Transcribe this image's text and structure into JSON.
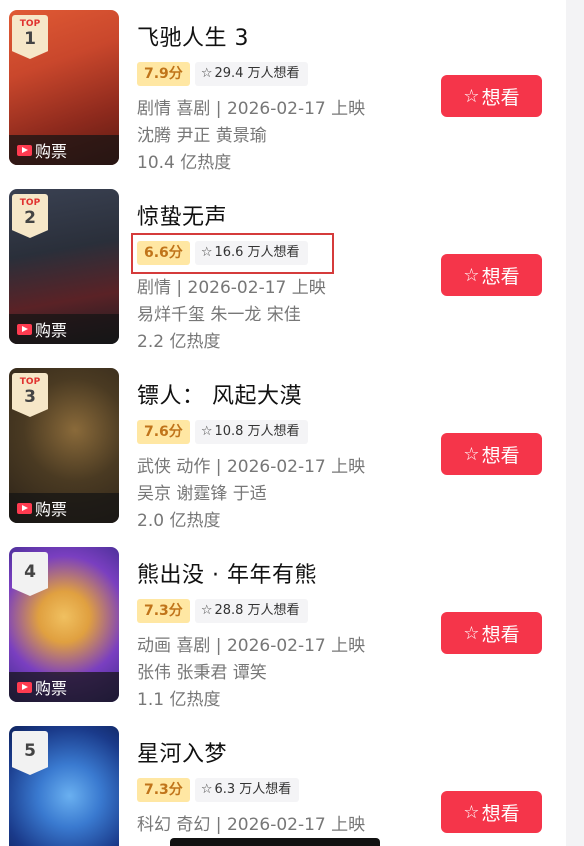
{
  "buy_label": "购票",
  "want_label": "想看",
  "top_label": "TOP",
  "movies": [
    {
      "rank": "1",
      "top": true,
      "title": "飞驰人生 3",
      "score": "7.9分",
      "wish": "29.4 万人想看",
      "genre_line": "剧情 喜剧 | 2026-02-17 上映",
      "cast": "沈腾 尹正 黄景瑜",
      "heat": "10.4 亿热度",
      "poster_colors": [
        "#c9472c",
        "#8e2a1d",
        "#e59a50"
      ]
    },
    {
      "rank": "2",
      "top": true,
      "title": "惊蛰无声",
      "score": "6.6分",
      "wish": "16.6 万人想看",
      "genre_line": "剧情 | 2026-02-17 上映",
      "cast": "易烊千玺 朱一龙 宋佳",
      "heat": "2.2 亿热度",
      "poster_colors": [
        "#2a2f3a",
        "#5a2226",
        "#1a1c22"
      ]
    },
    {
      "rank": "3",
      "top": true,
      "title": "镖人： 风起大漠",
      "score": "7.6分",
      "wish": "10.8 万人想看",
      "genre_line": "武侠 动作 | 2026-02-17 上映",
      "cast": "吴京 谢霆锋 于适",
      "heat": "2.0 亿热度",
      "poster_colors": [
        "#4a3a22",
        "#2a2118",
        "#8a6a3a"
      ]
    },
    {
      "rank": "4",
      "top": false,
      "title": "熊出没 · 年年有熊",
      "score": "7.3分",
      "wish": "28.8 万人想看",
      "genre_line": "动画 喜剧 | 2026-02-17 上映",
      "cast": "张伟 张秉君 谭笑",
      "heat": "1.1 亿热度",
      "poster_colors": [
        "#7a3fc0",
        "#e0a040",
        "#3a2a8a"
      ]
    },
    {
      "rank": "5",
      "top": false,
      "title": "星河入梦",
      "score": "7.3分",
      "wish": "6.3 万人想看",
      "genre_line": "科幻 奇幻 | 2026-02-17 上映",
      "cast": "",
      "heat": "",
      "poster_colors": [
        "#1a3a8a",
        "#3a7ad0",
        "#0a1a4a"
      ]
    }
  ],
  "colors": {
    "accent": "#f5354a",
    "score_bg": "#ffe7a3",
    "score_text": "#c0741a",
    "highlight": "#d53b3b"
  }
}
